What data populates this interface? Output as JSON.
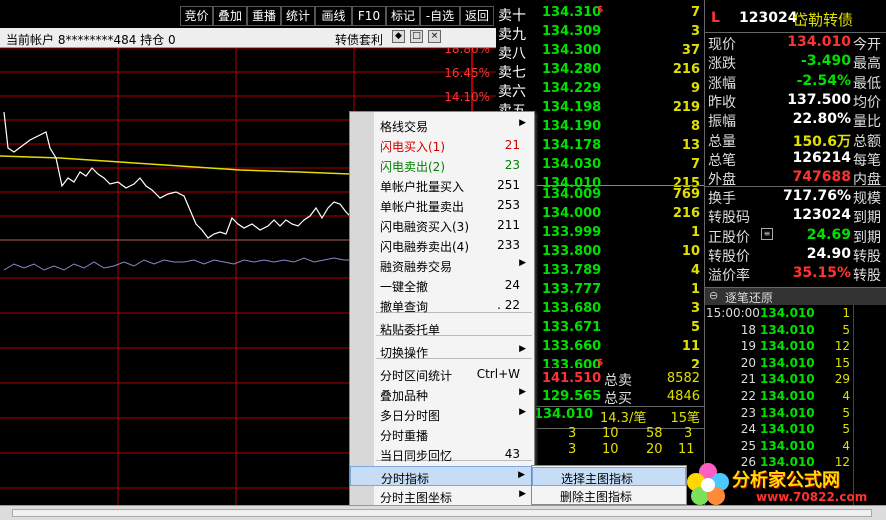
{
  "toolbar": {
    "buttons": [
      "竞价",
      "叠加",
      "重播",
      "统计",
      "画线",
      "F10",
      "标记",
      "-自选",
      "返回"
    ]
  },
  "account_bar": {
    "account": "当前帐户 8********484 持仓 0",
    "mode": "转债套利"
  },
  "chart": {
    "pct_labels": [
      "18.80%",
      "16.45%",
      "14.10%"
    ]
  },
  "order_book": {
    "asks": [
      {
        "label": "卖十",
        "price": "134.310",
        "mark": "$",
        "vol": "7"
      },
      {
        "label": "卖九",
        "price": "134.309",
        "mark": "",
        "vol": "3"
      },
      {
        "label": "卖八",
        "price": "134.300",
        "mark": "",
        "vol": "37"
      },
      {
        "label": "卖七",
        "price": "134.280",
        "mark": "",
        "vol": "216"
      },
      {
        "label": "卖六",
        "price": "134.229",
        "mark": "",
        "vol": "9"
      },
      {
        "label": "卖五",
        "price": "134.198",
        "mark": "",
        "vol": "219"
      },
      {
        "label": "",
        "price": "134.190",
        "mark": "",
        "vol": "8"
      },
      {
        "label": "",
        "price": "134.178",
        "mark": "",
        "vol": "13"
      },
      {
        "label": "",
        "price": "134.030",
        "mark": "",
        "vol": "7"
      },
      {
        "label": "",
        "price": "134.010",
        "mark": "",
        "vol": "215"
      }
    ],
    "bids": [
      {
        "price": "134.009",
        "mark": "",
        "vol": "769"
      },
      {
        "price": "134.000",
        "mark": "",
        "vol": "216"
      },
      {
        "price": "133.999",
        "mark": "",
        "vol": "1"
      },
      {
        "price": "133.800",
        "mark": "",
        "vol": "10"
      },
      {
        "price": "133.789",
        "mark": "",
        "vol": "4"
      },
      {
        "price": "133.777",
        "mark": "",
        "vol": "1"
      },
      {
        "price": "133.680",
        "mark": "",
        "vol": "3"
      },
      {
        "price": "133.671",
        "mark": "",
        "vol": "5"
      },
      {
        "price": "133.660",
        "mark": "",
        "vol": "11"
      },
      {
        "price": "133.600",
        "mark": "$",
        "vol": "2"
      }
    ]
  },
  "summary": {
    "sell_total_price": "141.510",
    "sell_total_label": "总卖",
    "sell_total_vol": "8582",
    "buy_total_price": "129.565",
    "buy_total_label": "总买",
    "buy_total_vol": "4846",
    "last_price": "134.010",
    "last_trade": "14.3/笔",
    "last_count": "15笔"
  },
  "trade_grid": [
    [
      "3",
      "10",
      "58",
      "3"
    ],
    [
      "3",
      "10",
      "20",
      "11"
    ]
  ],
  "quote": {
    "flag": "L",
    "code": "123024",
    "name": "岱勒转债",
    "rows": [
      {
        "k": "现价",
        "v": "134.010",
        "color": "#ff3232",
        "k2": "今开"
      },
      {
        "k": "涨跌",
        "v": "-3.490",
        "color": "#00e000",
        "k2": "最高"
      },
      {
        "k": "涨幅",
        "v": "-2.54%",
        "color": "#00e000",
        "k2": "最低"
      },
      {
        "k": "昨收",
        "v": "137.500",
        "color": "#ffffff",
        "k2": "均价"
      },
      {
        "k": "振幅",
        "v": "22.80%",
        "color": "#ffffff",
        "k2": "量比"
      },
      {
        "k": "总量",
        "v": "150.6万",
        "color": "#e0e000",
        "k2": "总额"
      },
      {
        "k": "总笔",
        "v": "126214",
        "color": "#ffffff",
        "k2": "每笔"
      },
      {
        "k": "外盘",
        "v": "747688",
        "color": "#ff3232",
        "k2": "内盘"
      }
    ],
    "rows2": [
      {
        "k": "换手",
        "v": "717.76%",
        "color": "#ffffff",
        "k2": "规模"
      },
      {
        "k": "转股码",
        "v": "123024",
        "color": "#ffffff",
        "k2": "到期"
      },
      {
        "k": "正股价",
        "v": "24.69",
        "color": "#00e000",
        "k2": "到期"
      },
      {
        "k": "转股价",
        "v": "24.90",
        "color": "#ffffff",
        "k2": "转股"
      },
      {
        "k": "溢价率",
        "v": "35.15%",
        "color": "#ff3232",
        "k2": "转股"
      }
    ]
  },
  "ticks_header": "逐笔还原",
  "ticks": [
    {
      "t": "15:00:00",
      "p": "134.010",
      "q": "1"
    },
    {
      "t": "18",
      "p": "134.010",
      "q": "5"
    },
    {
      "t": "19",
      "p": "134.010",
      "q": "12"
    },
    {
      "t": "20",
      "p": "134.010",
      "q": "15"
    },
    {
      "t": "21",
      "p": "134.010",
      "q": "29"
    },
    {
      "t": "22",
      "p": "134.010",
      "q": "4"
    },
    {
      "t": "23",
      "p": "134.010",
      "q": "5"
    },
    {
      "t": "24",
      "p": "134.010",
      "q": "5"
    },
    {
      "t": "25",
      "p": "134.010",
      "q": "4"
    },
    {
      "t": "26",
      "p": "134.010",
      "q": "12"
    }
  ],
  "menu": {
    "items": [
      {
        "label": "格线交易",
        "shortcut": "",
        "arrow": "▶",
        "color": "#000"
      },
      {
        "label": "闪电买入(1)",
        "shortcut": "21",
        "arrow": "",
        "color": "#d00000"
      },
      {
        "label": "闪电卖出(2)",
        "shortcut": "23",
        "arrow": "",
        "color": "#008000"
      },
      {
        "label": "单帐户批量买入",
        "shortcut": "251",
        "arrow": "",
        "color": "#000"
      },
      {
        "label": "单帐户批量卖出",
        "shortcut": "253",
        "arrow": "",
        "color": "#000"
      },
      {
        "label": "闪电融资买入(3)",
        "shortcut": "211",
        "arrow": "",
        "color": "#000"
      },
      {
        "label": "闪电融券卖出(4)",
        "shortcut": "233",
        "arrow": "",
        "color": "#000"
      },
      {
        "label": "融资融券交易",
        "shortcut": "",
        "arrow": "▶",
        "color": "#000"
      },
      {
        "label": "一键全撤",
        "shortcut": "24",
        "arrow": "",
        "color": "#000"
      },
      {
        "label": "撤单查询",
        "shortcut": ". 22",
        "arrow": "",
        "color": "#000"
      },
      {
        "label": "粘贴委托单",
        "shortcut": "",
        "arrow": "",
        "color": "#000"
      },
      {
        "label": "切换操作",
        "shortcut": "",
        "arrow": "▶",
        "color": "#000"
      },
      {
        "label": "分时区间统计",
        "shortcut": "Ctrl+W",
        "arrow": "",
        "color": "#000"
      },
      {
        "label": "叠加品种",
        "shortcut": "",
        "arrow": "▶",
        "color": "#000"
      },
      {
        "label": "多日分时图",
        "shortcut": "",
        "arrow": "▶",
        "color": "#000"
      },
      {
        "label": "分时重播",
        "shortcut": "",
        "arrow": "",
        "color": "#000"
      },
      {
        "label": "当日同步回忆",
        "shortcut": "43",
        "arrow": "",
        "color": "#000"
      },
      {
        "label": "分时指标",
        "shortcut": "",
        "arrow": "▶",
        "color": "#000"
      },
      {
        "label": "分时主图坐标",
        "shortcut": "",
        "arrow": "▶",
        "color": "#000"
      }
    ]
  },
  "submenu": {
    "items": [
      "选择主图指标",
      "删除主图指标"
    ]
  },
  "watermark": {
    "text": "分析家公式网",
    "url": "www.70822.com"
  }
}
